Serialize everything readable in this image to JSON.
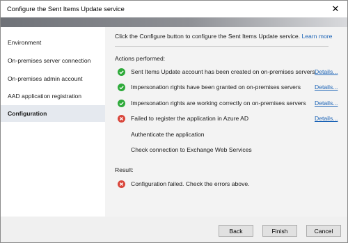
{
  "window": {
    "title": "Configure the Sent Items Update service",
    "close_glyph": "✕"
  },
  "sidebar": {
    "items": [
      {
        "label": "Environment",
        "active": false
      },
      {
        "label": "On-premises server connection",
        "active": false
      },
      {
        "label": "On-premises admin account",
        "active": false
      },
      {
        "label": "AAD application registration",
        "active": false
      },
      {
        "label": "Configuration",
        "active": true
      }
    ]
  },
  "main": {
    "intro_text": "Click the Configure button to configure the Sent Items Update service.",
    "learn_more": "Learn more",
    "actions_heading": "Actions performed:",
    "actions": [
      {
        "status": "success",
        "icon": "check-circle-icon",
        "text": "Sent Items Update account has been created on on-premises servers",
        "details": "Details..."
      },
      {
        "status": "success",
        "icon": "check-circle-icon",
        "text": "Impersonation rights have been granted on on-premises servers",
        "details": "Details..."
      },
      {
        "status": "success",
        "icon": "check-circle-icon",
        "text": "Impersonation rights are working correctly on on-premises servers",
        "details": "Details..."
      },
      {
        "status": "error",
        "icon": "error-circle-icon",
        "text": "Failed to register the application in Azure AD",
        "details": "Details..."
      },
      {
        "status": "pending",
        "icon": "",
        "text": "Authenticate the application",
        "details": ""
      },
      {
        "status": "pending",
        "icon": "",
        "text": "Check connection to Exchange Web Services",
        "details": ""
      }
    ],
    "result_heading": "Result:",
    "result": {
      "status": "error",
      "icon": "error-circle-icon",
      "text": "Configuration failed. Check the errors above."
    }
  },
  "footer": {
    "back_label": "Back",
    "finish_label": "Finish",
    "cancel_label": "Cancel"
  },
  "colors": {
    "success": "#2eaa3a",
    "error": "#d9463b",
    "link": "#1b63b6",
    "selected_nav": "#e5e9ef"
  }
}
